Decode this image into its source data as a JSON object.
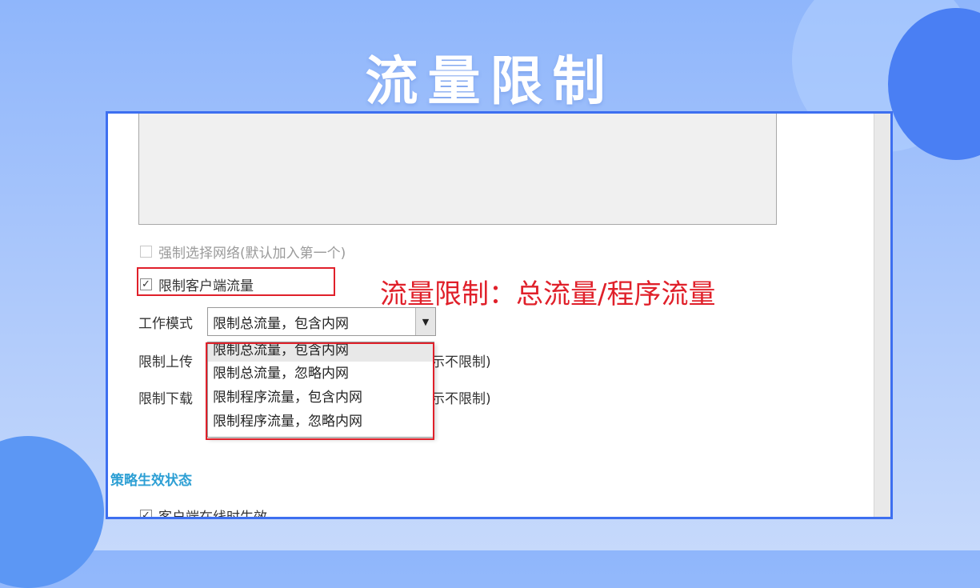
{
  "slide": {
    "title": "流量限制"
  },
  "annotation": {
    "text": "流量限制：总流量/程序流量"
  },
  "settings": {
    "force_network": {
      "label": "强制选择网络(默认加入第一个)",
      "checked": false,
      "disabled": true
    },
    "limit_client_traffic": {
      "label": "限制客户端流量",
      "checked": true
    },
    "work_mode": {
      "label": "工作模式",
      "selected": "限制总流量，包含内网",
      "arrow": "▼",
      "options": [
        "限制总流量，包含内网",
        "限制总流量，忽略内网",
        "限制程序流量，包含内网",
        "限制程序流量，忽略内网"
      ]
    },
    "upload_limit": {
      "label_visible": "限制上传",
      "suffix_visible": "示不限制)"
    },
    "download_limit": {
      "label_visible": "限制下载",
      "suffix_visible": "示不限制)"
    },
    "policy_section": {
      "title": "策略生效状态"
    },
    "client_online": {
      "label_partial": "客户端在线时生效",
      "checked": true
    }
  },
  "glyphs": {
    "check": "✓"
  },
  "colors": {
    "frame_border": "#3d6ff0",
    "highlight_red": "#e0202a",
    "section_blue": "#2d9fd4"
  }
}
